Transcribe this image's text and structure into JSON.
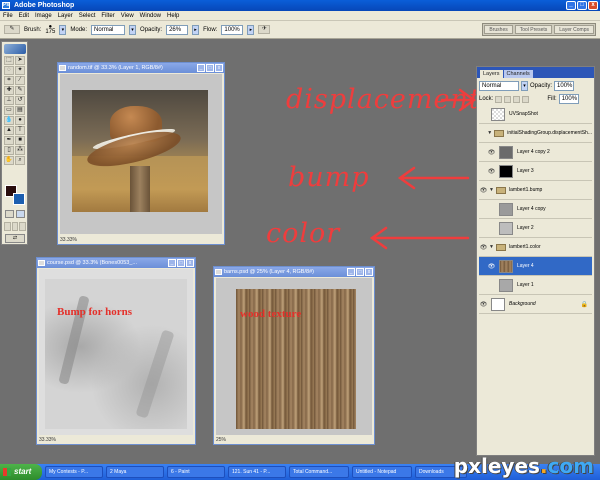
{
  "window": {
    "title": "Adobe Photoshop",
    "min": "_",
    "max": "□",
    "close": "x"
  },
  "menu": [
    "File",
    "Edit",
    "Image",
    "Layer",
    "Select",
    "Filter",
    "View",
    "Window",
    "Help"
  ],
  "options": {
    "brush_label": "Brush:",
    "brush_size": "175",
    "mode_label": "Mode:",
    "mode_value": "Normal",
    "opacity_label": "Opacity:",
    "opacity_value": "26%",
    "flow_label": "Flow:",
    "flow_value": "100%",
    "wells": [
      "Brushes",
      "Tool Presets",
      "Layer Comps"
    ]
  },
  "docs": {
    "random": {
      "title": "random.tif @ 33.3% (Layer 1, RGB/8#)",
      "zoom": "33.33%"
    },
    "course": {
      "title": "course.psd @ 33.3% (Bones0053_...",
      "zoom": "33.33%",
      "label": "Bump for horns"
    },
    "barns": {
      "title": "barns.psd @ 25% (Layer 4, RGB/8#)",
      "zoom": "25%",
      "label": "wood texture"
    }
  },
  "annotations": {
    "a1": "displacement",
    "a2": "bump",
    "a3": "color"
  },
  "layers_panel": {
    "tabs": [
      "Layers",
      "Channels"
    ],
    "blend_mode": "Normal",
    "opacity_label": "Opacity:",
    "opacity_value": "100%",
    "lock_label": "Lock:",
    "fill_label": "Fill:",
    "fill_value": "100%",
    "rows": [
      {
        "name": "UVSnapShot",
        "kind": "layer",
        "thumb": "#e8e8e8"
      },
      {
        "name": "initialShadingGroup.displacementSh...",
        "kind": "group"
      },
      {
        "name": "Layer 4 copy 2",
        "kind": "layer",
        "thumb": "#6b6b6b"
      },
      {
        "name": "Layer 3",
        "kind": "layer",
        "thumb": "#000000"
      },
      {
        "name": "lambert1.bump",
        "kind": "group"
      },
      {
        "name": "Layer 4 copy",
        "kind": "layer",
        "thumb": "#9a9a9a"
      },
      {
        "name": "Layer 2",
        "kind": "layer",
        "thumb": "#bdbdbd"
      },
      {
        "name": "lambert1.color",
        "kind": "group"
      },
      {
        "name": "Layer 4",
        "kind": "layer",
        "thumb": "#8a6e52",
        "selected": true
      },
      {
        "name": "Layer 1",
        "kind": "layer",
        "thumb": "#a8a8a8"
      },
      {
        "name": "Background",
        "kind": "layer",
        "thumb": "#ffffff",
        "italic": true
      }
    ]
  },
  "taskbar": {
    "start": "start",
    "items": [
      "My Contests - P...",
      "2 Maya",
      "6 - Paint",
      "121. Sun 41 - P...",
      "Total Command...",
      "Untitled - Notepad",
      "Downloads"
    ]
  },
  "watermark": {
    "a": "pxleyes",
    "b": ".",
    "c": "com"
  },
  "colors": {
    "accent": "#2d56b7",
    "annotation": "#ef3d3d",
    "selected_row": "#3169c6"
  }
}
